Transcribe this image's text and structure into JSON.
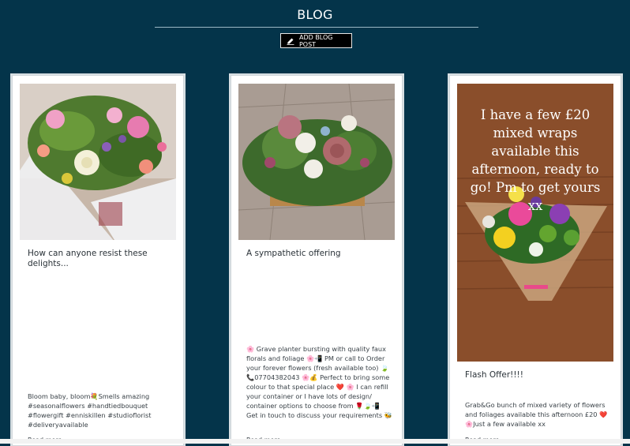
{
  "header": {
    "title": "BLOG",
    "add_button_label": "ADD BLOG POST",
    "add_button_icon": "edit-pencil-icon"
  },
  "posts": [
    {
      "title": "How can anyone resist these delights...",
      "excerpt": "Bloom baby, bloom💐Smells amazing #seasonalflowers #handtiedbouquet #flowergift #enniskillen #studioflorist #deliveryavailable",
      "read_more": "Read more"
    },
    {
      "title": "A sympathetic offering",
      "excerpt": "🌸 Grave planter bursting with quality faux florals and foliage 🌸📲 PM or call to Order your forever flowers (fresh available too) 🍃📞07704382043 🌸💰 Perfect to bring some colour to that special place ❤️ 🌸 I can refill your container or I have lots of design/ container options to choose from 🌹🍃📲 Get in touch to discuss your requirements 🐝",
      "read_more": "Read more"
    },
    {
      "title": "Flash Offer!!!!",
      "image_text": "I have a few £20 mixed wraps available this afternoon, ready to go! Pm to get yours xx",
      "excerpt": "Grab&Go bunch of mixed variety of flowers and foliages available this afternoon £20 ❤️🌸Just a few available xx",
      "read_more": "Read more"
    }
  ]
}
